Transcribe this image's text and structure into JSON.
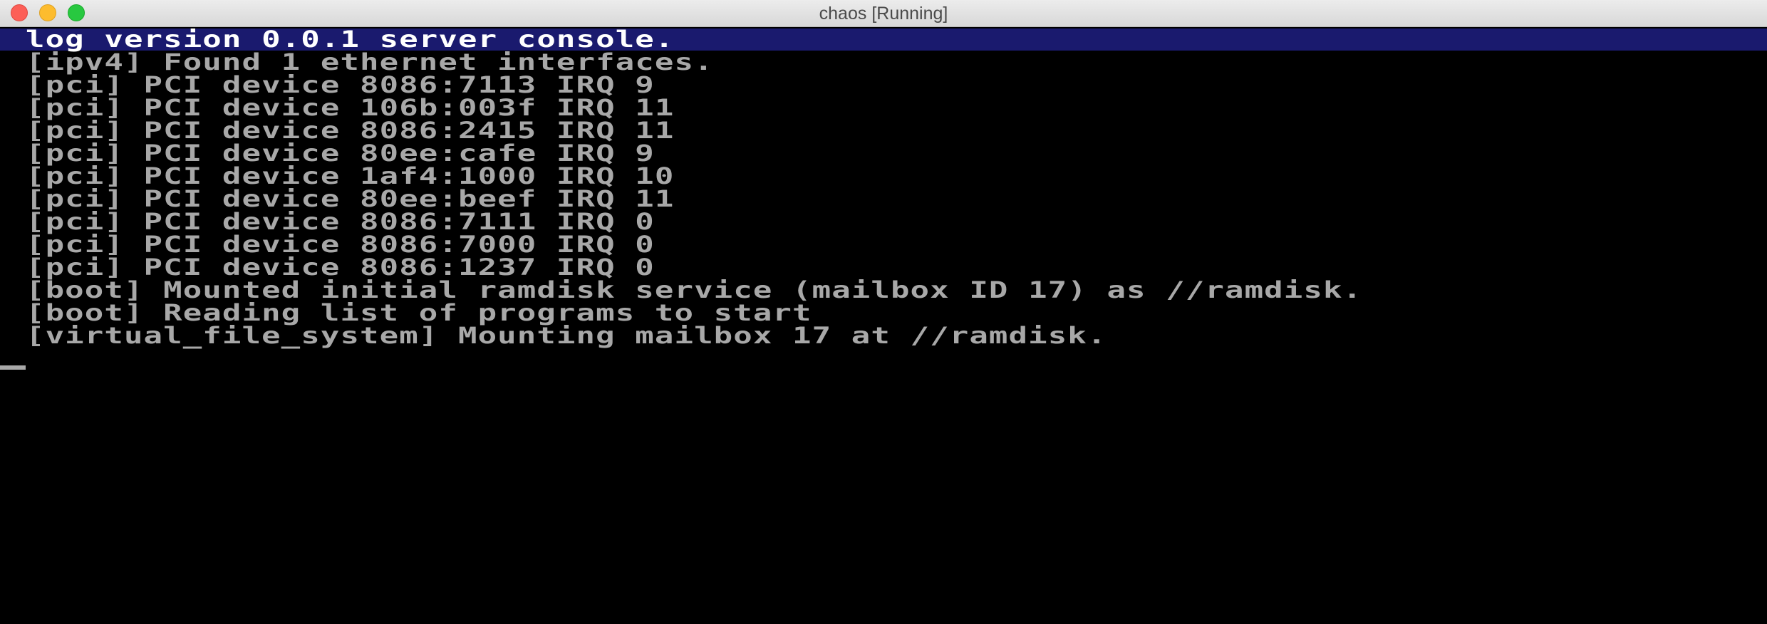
{
  "window": {
    "title": "chaos [Running]"
  },
  "console": {
    "header": "log version 0.0.1 server console.",
    "lines": [
      "[ipv4] Found 1 ethernet interfaces.",
      "[pci] PCI device 8086:7113 IRQ 9",
      "[pci] PCI device 106b:003f IRQ 11",
      "[pci] PCI device 8086:2415 IRQ 11",
      "[pci] PCI device 80ee:cafe IRQ 9",
      "[pci] PCI device 1af4:1000 IRQ 10",
      "[pci] PCI device 80ee:beef IRQ 11",
      "[pci] PCI device 8086:7111 IRQ 0",
      "[pci] PCI device 8086:7000 IRQ 0",
      "[pci] PCI device 8086:1237 IRQ 0",
      "[boot] Mounted initial ramdisk service (mailbox ID 17) as //ramdisk.",
      "[boot] Reading list of programs to start",
      "[virtual_file_system] Mounting mailbox 17 at //ramdisk."
    ]
  },
  "colors": {
    "header_bar": "#1a1a6e",
    "text": "#a8a8a8",
    "header_text": "#ffffff",
    "background": "#000000"
  }
}
